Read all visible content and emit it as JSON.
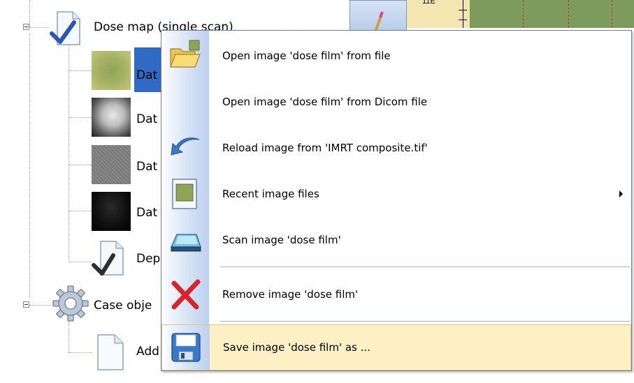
{
  "tree": {
    "dose_map_label": "Dose map (single scan)",
    "items": [
      {
        "label": "Dat"
      },
      {
        "label": "Dat"
      },
      {
        "label": "Dat"
      },
      {
        "label": "Dat"
      },
      {
        "label": "Dep"
      }
    ],
    "case_objects_label": "Case obje",
    "add_label": "Add"
  },
  "toolbar": {
    "corner_text": "11E"
  },
  "menu": {
    "items": [
      {
        "label": "Open image 'dose film' from file",
        "icon": "folder-open-icon"
      },
      {
        "label": "Open image 'dose film' from Dicom file",
        "icon": ""
      },
      {
        "label": "Reload image from 'IMRT composite.tif'",
        "icon": "reload-arrow-icon"
      },
      {
        "label": "Recent image files",
        "icon": "image-file-icon",
        "submenu": true
      },
      {
        "label": "Scan image 'dose film'",
        "icon": "scanner-icon"
      },
      {
        "label": "Remove image 'dose film'",
        "icon": "red-x-icon"
      },
      {
        "label": "Save image 'dose film' as ...",
        "icon": "floppy-disk-icon"
      }
    ]
  },
  "colors": {
    "selection": "#316ac5",
    "menu_highlight": "#fcf0c4",
    "canvas_green": "#7e9b5e"
  }
}
